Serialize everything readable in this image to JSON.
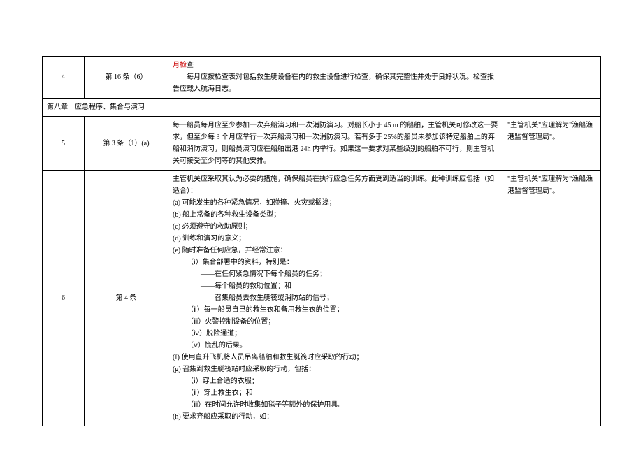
{
  "rows": {
    "row4": {
      "num": "4",
      "article": "第 16 条（6）",
      "redTitle": "月检",
      "redTail": "查",
      "content": "每月应按检查表对包括救生艇设备在内的救生设备进行检查，确保其完整性并处于良好状况。检查报告应载入航海日志。",
      "note": ""
    },
    "sectionHeader": "第八章　应急程序、集合与演习",
    "row5": {
      "num": "5",
      "article": "第 3 条（1）(a)",
      "content": "每一船员每月应至少参加一次弃船演习和一次消防演习。对船长小于 45 m 的船舶，主管机关可修改这一要求，但至少每 3 个月应举行一次弃船演习和一次消防演习。若有多于 25%的船员未参加该特定船舶上的弃船和消防演习，则船员演习应在船舶出港 24h 内举行。如果这一要求对某些级别的船舶不可行，则主管机关可接受至少同等的其他安排。",
      "note": "\"主管机关\"应理解为\"渔船渔港监督管理局\"。"
    },
    "row6": {
      "num": "6",
      "article": "第 4 条",
      "intro": "主管机关应采取其认为必要的措施，确保船员在执行应急任务方面受到适当的训练。此种训练应包括（如适合）：",
      "a": "(a) 可能发生的各种紧急情况，如碰撞、火灾或搁浅；",
      "b": "(b) 船上常备的各种救生设备类型；",
      "c": "(c) 必须遵守的救助原则；",
      "d": "(d) 训练和演习的意义；",
      "e": "(e) 随时准备任何应急，并经常注意：",
      "ei": "（ⅰ）集合部署中的资料，特别是：",
      "ei1": "——在任何紧急情况下每个船员的任务；",
      "ei2": "——每个船员的救助位置；和",
      "ei3": "——召集船员去救生艇筏或消防站的信号；",
      "eii": "（ⅱ）每一船员自己的救生衣和备用救生衣的位置；",
      "eiii": "（ⅲ）火警控制设备的位置；",
      "eiv": "（ⅳ）脱险通道；",
      "ev": "（ⅴ）慌乱的后果。",
      "f": "(f) 使用直升飞机将人员吊离船舶和救生艇筏时应采取的行动；",
      "g": "(g) 召集到救生艇筏站时应采取的行动，包括：",
      "gi": "（ⅰ）穿上合适的衣服；",
      "gii": "（ⅱ）穿上救生衣；和",
      "giii": "（ⅲ）在时间允许时收集如毯子等额外的保护用具。",
      "h": "(h) 要求弃船应采取的行动，如：",
      "note": "\"主管机关\"应理解为\"渔船渔港监督管理局\"。"
    }
  }
}
